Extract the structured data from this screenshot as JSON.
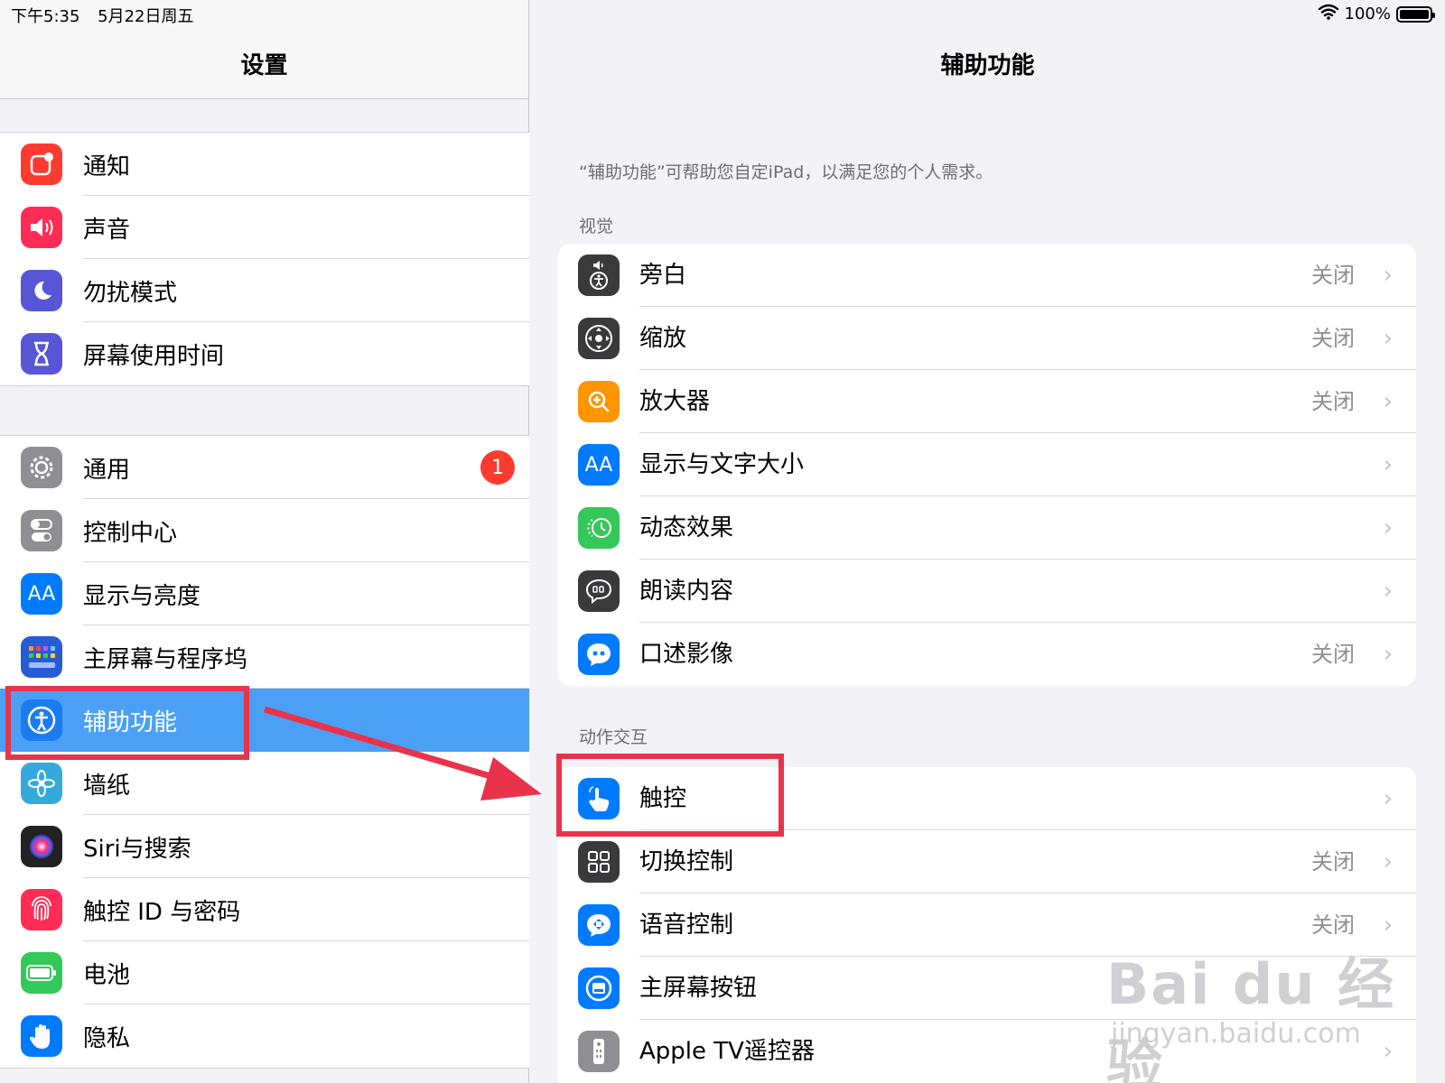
{
  "status_bar": {
    "time": "下午5:35",
    "date": "5月22日周五",
    "battery_text": "100%"
  },
  "sidebar": {
    "title": "设置",
    "group1": [
      {
        "label": "通知",
        "icon": "notification-icon",
        "color": "#ff3b30"
      },
      {
        "label": "声音",
        "icon": "speaker-icon",
        "color": "#ff2d55"
      },
      {
        "label": "勿扰模式",
        "icon": "moon-icon",
        "color": "#5856d6"
      },
      {
        "label": "屏幕使用时间",
        "icon": "hourglass-icon",
        "color": "#5856d6"
      }
    ],
    "group2": [
      {
        "label": "通用",
        "icon": "gear-icon",
        "color": "#8e8e93",
        "badge": "1"
      },
      {
        "label": "控制中心",
        "icon": "toggles-icon",
        "color": "#8e8e93"
      },
      {
        "label": "显示与亮度",
        "icon": "aa-icon",
        "color": "#007aff"
      },
      {
        "label": "主屏幕与程序坞",
        "icon": "grid-icon",
        "color": "#2a5bd7"
      },
      {
        "label": "辅助功能",
        "icon": "accessibility-icon",
        "color": "#1a7cf0",
        "selected": true
      },
      {
        "label": "墙纸",
        "icon": "flower-icon",
        "color": "#34aadc"
      },
      {
        "label": "Siri与搜索",
        "icon": "siri-icon",
        "color": "#222222"
      },
      {
        "label": "触控 ID 与密码",
        "icon": "fingerprint-icon",
        "color": "#ff2d55"
      },
      {
        "label": "电池",
        "icon": "battery-icon",
        "color": "#34c759"
      },
      {
        "label": "隐私",
        "icon": "hand-icon",
        "color": "#007aff"
      }
    ]
  },
  "main": {
    "title": "辅助功能",
    "description": "“辅助功能”可帮助您自定iPad，以满足您的个人需求。",
    "section_vision": "视觉",
    "vision_items": [
      {
        "label": "旁白",
        "value": "关闭",
        "icon": "voiceover-icon",
        "color": "#3a3a3c"
      },
      {
        "label": "缩放",
        "value": "关闭",
        "icon": "zoom-icon",
        "color": "#3a3a3c"
      },
      {
        "label": "放大器",
        "value": "关闭",
        "icon": "magnifier-icon",
        "color": "#ff9500"
      },
      {
        "label": "显示与文字大小",
        "value": "",
        "icon": "aa-icon",
        "color": "#007aff"
      },
      {
        "label": "动态效果",
        "value": "",
        "icon": "motion-icon",
        "color": "#34c759"
      },
      {
        "label": "朗读内容",
        "value": "",
        "icon": "speech-bubble-icon",
        "color": "#3a3a3c"
      },
      {
        "label": "口述影像",
        "value": "关闭",
        "icon": "quote-bubble-icon",
        "color": "#007aff"
      }
    ],
    "section_interaction": "动作交互",
    "interaction_items": [
      {
        "label": "触控",
        "value": "",
        "icon": "touch-hand-icon",
        "color": "#007aff"
      },
      {
        "label": "切换控制",
        "value": "关闭",
        "icon": "switch-grid-icon",
        "color": "#3a3a3c"
      },
      {
        "label": "语音控制",
        "value": "关闭",
        "icon": "voice-control-icon",
        "color": "#007aff"
      },
      {
        "label": "主屏幕按钮",
        "value": "",
        "icon": "home-button-icon",
        "color": "#007aff"
      },
      {
        "label": "Apple TV遥控器",
        "value": "",
        "icon": "remote-icon",
        "color": "#8e8e93"
      }
    ]
  },
  "annotation_color": "#e8334a",
  "watermark": {
    "brand": "Bai du 经验",
    "url": "jingyan.baidu.com"
  }
}
